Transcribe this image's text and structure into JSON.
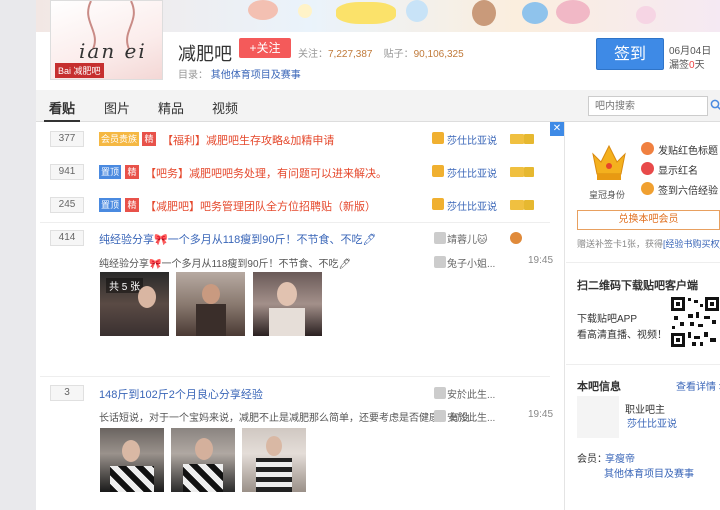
{
  "forum": {
    "name": "减肥吧",
    "follow_label": "+关注",
    "followers_label": "关注：",
    "followers": "7,227,387",
    "posts_label": "贴子：",
    "posts": "90,106,325",
    "catalog_label": "目录：",
    "catalog_value": "其他体育项目及赛事",
    "logo_script": "ian  ei",
    "logo_badge": "Bai 减肥吧"
  },
  "signin": {
    "button": "签到",
    "date": "06月04日",
    "missed_prefix": "漏签",
    "missed_count": "0",
    "missed_suffix": "天"
  },
  "tabs": [
    "看贴",
    "图片",
    "精品",
    "视频"
  ],
  "search": {
    "placeholder": "吧内搜索"
  },
  "threads": [
    {
      "replies": "377",
      "tags": [
        "会员贵族",
        "精"
      ],
      "title": "【福利】减肥吧生存攻略&加精申请",
      "author": "莎仕比亚说"
    },
    {
      "replies": "941",
      "tags": [
        "置顶",
        "精"
      ],
      "title": "【吧务】减肥吧吧务处理，有问题可以进来解决。",
      "author": "莎仕比亚说"
    },
    {
      "replies": "245",
      "tags": [
        "置顶",
        "精"
      ],
      "title": "【减肥吧】吧务管理团队全方位招聘贴（新版）",
      "author": "莎仕比亚说"
    },
    {
      "replies": "414",
      "title": "纯经验分享🎀一个多月从118瘦到90斤！不节食、不吃🖊",
      "author": "靖蓉儿🐱",
      "excerpt": "纯经验分享🎀一个多月从118瘦到90斤！不节食、不吃🖊",
      "last_author": "兔子小姐...",
      "time": "19:45",
      "image_count": "共 5 张"
    },
    {
      "replies": "3",
      "title": "148斤到102斤2个月良心分享经验",
      "author": "安於此生...",
      "excerpt": "长话短说，对于一个宝妈来说，减肥不止是减肥那么简单，还要考虑是否健康，有没...",
      "last_author": "安於此生...",
      "time": "19:45"
    }
  ],
  "sidebar": {
    "crown_label": "皇冠身份",
    "perks": [
      "发贴红色标题",
      "显示红名",
      "签到六倍经验"
    ],
    "vip_button": "兑换本吧会员",
    "gift_prefix": "赠送补签卡1张，获得",
    "gift_link": "[经验书购买权]",
    "qr_title": "扫二维码下载贴吧客户端",
    "qr_text1": "下载贴吧APP",
    "qr_text2": "看高清直播、视频！",
    "info_title": "本吧信息",
    "info_more": "查看详情 >",
    "owner_role": "职业吧主",
    "owner_name": "莎仕比亚说",
    "member_label": "会员：",
    "member_name": "享瘦帝",
    "category": "其他体育项目及赛事"
  },
  "colors": {
    "accent_blue": "#3e8ae6",
    "follow_red": "#f45a5a",
    "title_red": "#e5482c",
    "link_blue": "#3a66b8"
  }
}
